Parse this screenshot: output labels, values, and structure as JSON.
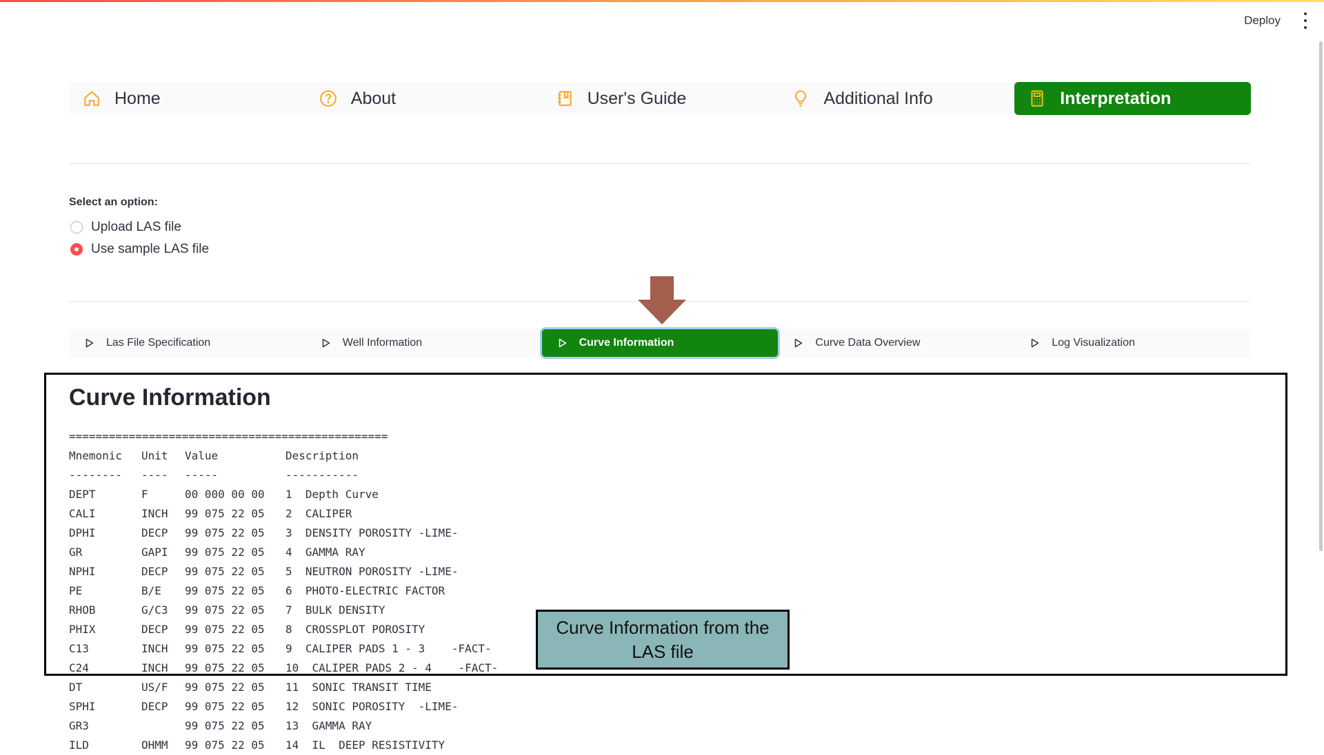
{
  "header": {
    "deploy_label": "Deploy"
  },
  "nav": {
    "items": [
      {
        "label": "Home",
        "icon": "home-icon"
      },
      {
        "label": "About",
        "icon": "question-circle-icon"
      },
      {
        "label": "User's Guide",
        "icon": "journal-icon"
      },
      {
        "label": "Additional Info",
        "icon": "lightbulb-icon"
      },
      {
        "label": "Interpretation",
        "icon": "calculator-icon",
        "active": true
      }
    ]
  },
  "options": {
    "label": "Select an option:",
    "choices": [
      {
        "label": "Upload LAS file",
        "selected": false
      },
      {
        "label": "Use sample LAS file",
        "selected": true
      }
    ]
  },
  "subtabs": [
    {
      "label": "Las File Specification"
    },
    {
      "label": "Well Information"
    },
    {
      "label": "Curve Information",
      "active": true
    },
    {
      "label": "Curve Data Overview"
    },
    {
      "label": "Log Visualization"
    }
  ],
  "section": {
    "title": "Curve Information",
    "separator": "================================================",
    "header": {
      "mnemonic": "Mnemonic",
      "unit": "Unit",
      "value": "Value",
      "description": "Description"
    },
    "header_dashes": {
      "mnemonic": "--------",
      "unit": "----",
      "value": "-----",
      "description": "-----------"
    },
    "rows": [
      {
        "mnemonic": "DEPT",
        "unit": "F",
        "value": "00 000 00 00",
        "description": "1  Depth Curve"
      },
      {
        "mnemonic": "CALI",
        "unit": "INCH",
        "value": "99 075 22 05",
        "description": "2  CALIPER"
      },
      {
        "mnemonic": "DPHI",
        "unit": "DECP",
        "value": "99 075 22 05",
        "description": "3  DENSITY POROSITY -LIME-"
      },
      {
        "mnemonic": "GR",
        "unit": "GAPI",
        "value": "99 075 22 05",
        "description": "4  GAMMA RAY"
      },
      {
        "mnemonic": "NPHI",
        "unit": "DECP",
        "value": "99 075 22 05",
        "description": "5  NEUTRON POROSITY -LIME-"
      },
      {
        "mnemonic": "PE",
        "unit": "B/E",
        "value": "99 075 22 05",
        "description": "6  PHOTO-ELECTRIC FACTOR"
      },
      {
        "mnemonic": "RHOB",
        "unit": "G/C3",
        "value": "99 075 22 05",
        "description": "7  BULK DENSITY"
      },
      {
        "mnemonic": "PHIX",
        "unit": "DECP",
        "value": "99 075 22 05",
        "description": "8  CROSSPLOT POROSITY"
      },
      {
        "mnemonic": "C13",
        "unit": "INCH",
        "value": "99 075 22 05",
        "description": "9  CALIPER PADS 1 - 3    -FACT-"
      },
      {
        "mnemonic": "C24",
        "unit": "INCH",
        "value": "99 075 22 05",
        "description": "10  CALIPER PADS 2 - 4    -FACT-"
      },
      {
        "mnemonic": "DT",
        "unit": "US/F",
        "value": "99 075 22 05",
        "description": "11  SONIC TRANSIT TIME"
      },
      {
        "mnemonic": "SPHI",
        "unit": "DECP",
        "value": "99 075 22 05",
        "description": "12  SONIC POROSITY  -LIME-"
      },
      {
        "mnemonic": "GR3",
        "unit": "",
        "value": "99 075 22 05",
        "description": "13  GAMMA RAY"
      },
      {
        "mnemonic": "ILD",
        "unit": "OHMM",
        "value": "99 075 22 05",
        "description": "14  IL  DEEP RESISTIVITY"
      }
    ]
  },
  "callout": {
    "text": "Curve Information from the LAS file"
  },
  "colors": {
    "accent_green": "#12850f",
    "radio_red": "#ff4b4b",
    "arrow": "#a45f4d",
    "callout_bg": "#8ab6b8"
  }
}
